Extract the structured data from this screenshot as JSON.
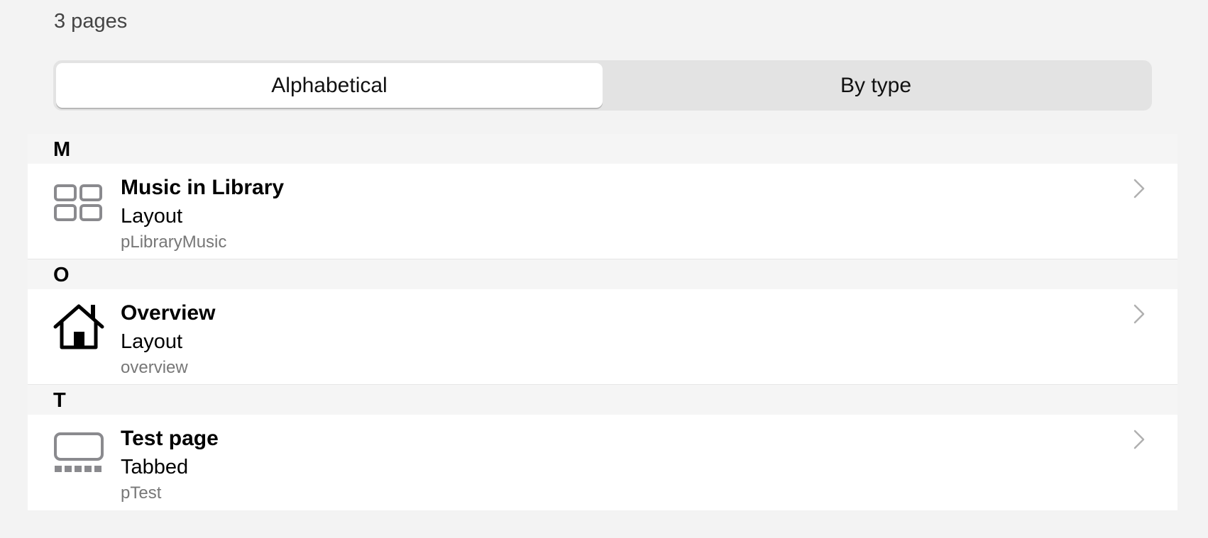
{
  "header": {
    "page_count": "3 pages"
  },
  "segmented": {
    "options": [
      {
        "label": "Alphabetical",
        "selected": true
      },
      {
        "label": "By type",
        "selected": false
      }
    ]
  },
  "sections": [
    {
      "letter": "M",
      "items": [
        {
          "title": "Music in Library",
          "type": "Layout",
          "id": "pLibraryMusic",
          "icon": "grid-layout-icon"
        }
      ]
    },
    {
      "letter": "O",
      "items": [
        {
          "title": "Overview",
          "type": "Layout",
          "id": "overview",
          "icon": "home-icon"
        }
      ]
    },
    {
      "letter": "T",
      "items": [
        {
          "title": "Test page",
          "type": "Tabbed",
          "id": "pTest",
          "icon": "tabbed-page-icon"
        }
      ]
    }
  ],
  "colors": {
    "background": "#f3f3f3",
    "row_background": "#ffffff",
    "segment_track": "#e3e3e3",
    "icon_gray": "#8a8a8e",
    "chevron_gray": "#b0b0b0"
  }
}
